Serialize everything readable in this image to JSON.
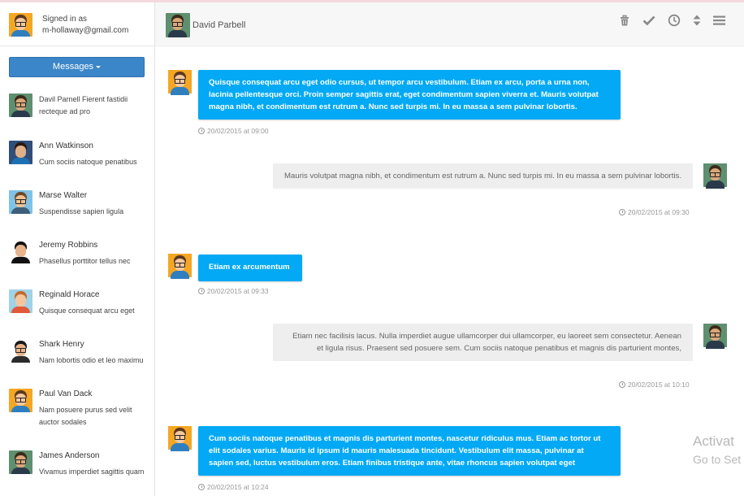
{
  "current_user": {
    "signed_in_label": "Signed in as",
    "email": "m-hollaway@gmail.com",
    "avatar_icon": "user-avatar-icon"
  },
  "sidebar": {
    "messages_button_label": "Messages",
    "contacts": [
      {
        "name": "Davil Parnell",
        "snippet": "Fierent fastidii recteque ad pro"
      },
      {
        "name": "Ann Watkinson",
        "snippet": "Cum sociis natoque penatibus"
      },
      {
        "name": "Marse Walter",
        "snippet": "Suspendisse sapien ligula"
      },
      {
        "name": "Jeremy Robbins",
        "snippet": "Phasellus porttitor tellus nec"
      },
      {
        "name": "Reginald Horace",
        "snippet": "Quisque consequat arcu eget"
      },
      {
        "name": "Shark Henry",
        "snippet": "Nam lobortis odio et leo maximu"
      },
      {
        "name": "Paul Van Dack",
        "snippet": "Nam posuere purus sed velit auctor sodales"
      },
      {
        "name": "James Anderson",
        "snippet": "Vivamus imperdiet sagittis quam"
      }
    ]
  },
  "header": {
    "contact_name": "David Parbell",
    "icons": [
      "trash-icon",
      "check-icon",
      "clock-icon",
      "sort-icon",
      "menu-icon"
    ]
  },
  "messages": [
    {
      "direction": "out",
      "text": "Quisque consequat arcu eget odio cursus, ut tempor arcu vestibulum. Etiam ex arcu, porta a urna non, lacinia pellentesque orci. Proin semper sagittis erat, eget condimentum sapien viverra et. Mauris volutpat magna nibh, et condimentum est rutrum a. Nunc sed turpis mi. In eu massa a sem pulvinar lobortis.",
      "time": "20/02/2015 at 09:00"
    },
    {
      "direction": "in",
      "text": "Mauris volutpat magna nibh, et condimentum est rutrum a. Nunc sed turpis mi. In eu massa a sem pulvinar lobortis.",
      "time": "20/02/2015 at 09:30"
    },
    {
      "direction": "out",
      "text": "Etiam ex arcumentum",
      "time": "20/02/2015 at 09:33"
    },
    {
      "direction": "in",
      "text": "Etiam nec facilisis lacus. Nulla imperdiet augue ullamcorper dui ullamcorper, eu laoreet sem consectetur. Aenean et ligula risus. Praesent sed posuere sem. Cum sociis natoque penatibus et magnis dis parturient montes,",
      "time": "20/02/2015 at 10:10"
    },
    {
      "direction": "out",
      "text": "Cum sociis natoque penatibus et magnis dis parturient montes, nascetur ridiculus mus. Etiam ac tortor ut elit sodales varius. Mauris id ipsum id mauris malesuada tincidunt. Vestibulum elit massa, pulvinar at sapien sed, luctus vestibulum eros. Etiam finibus tristique ante, vitae rhoncus sapien volutpat eget",
      "time": "20/02/2015 at 10:24"
    }
  ],
  "overlay": {
    "line1": "Activat",
    "line2": "Go to Set"
  },
  "colors": {
    "accent_button": "#3a86c8",
    "outgoing_bubble": "#03a9f4",
    "incoming_bubble": "#eeeeee"
  }
}
